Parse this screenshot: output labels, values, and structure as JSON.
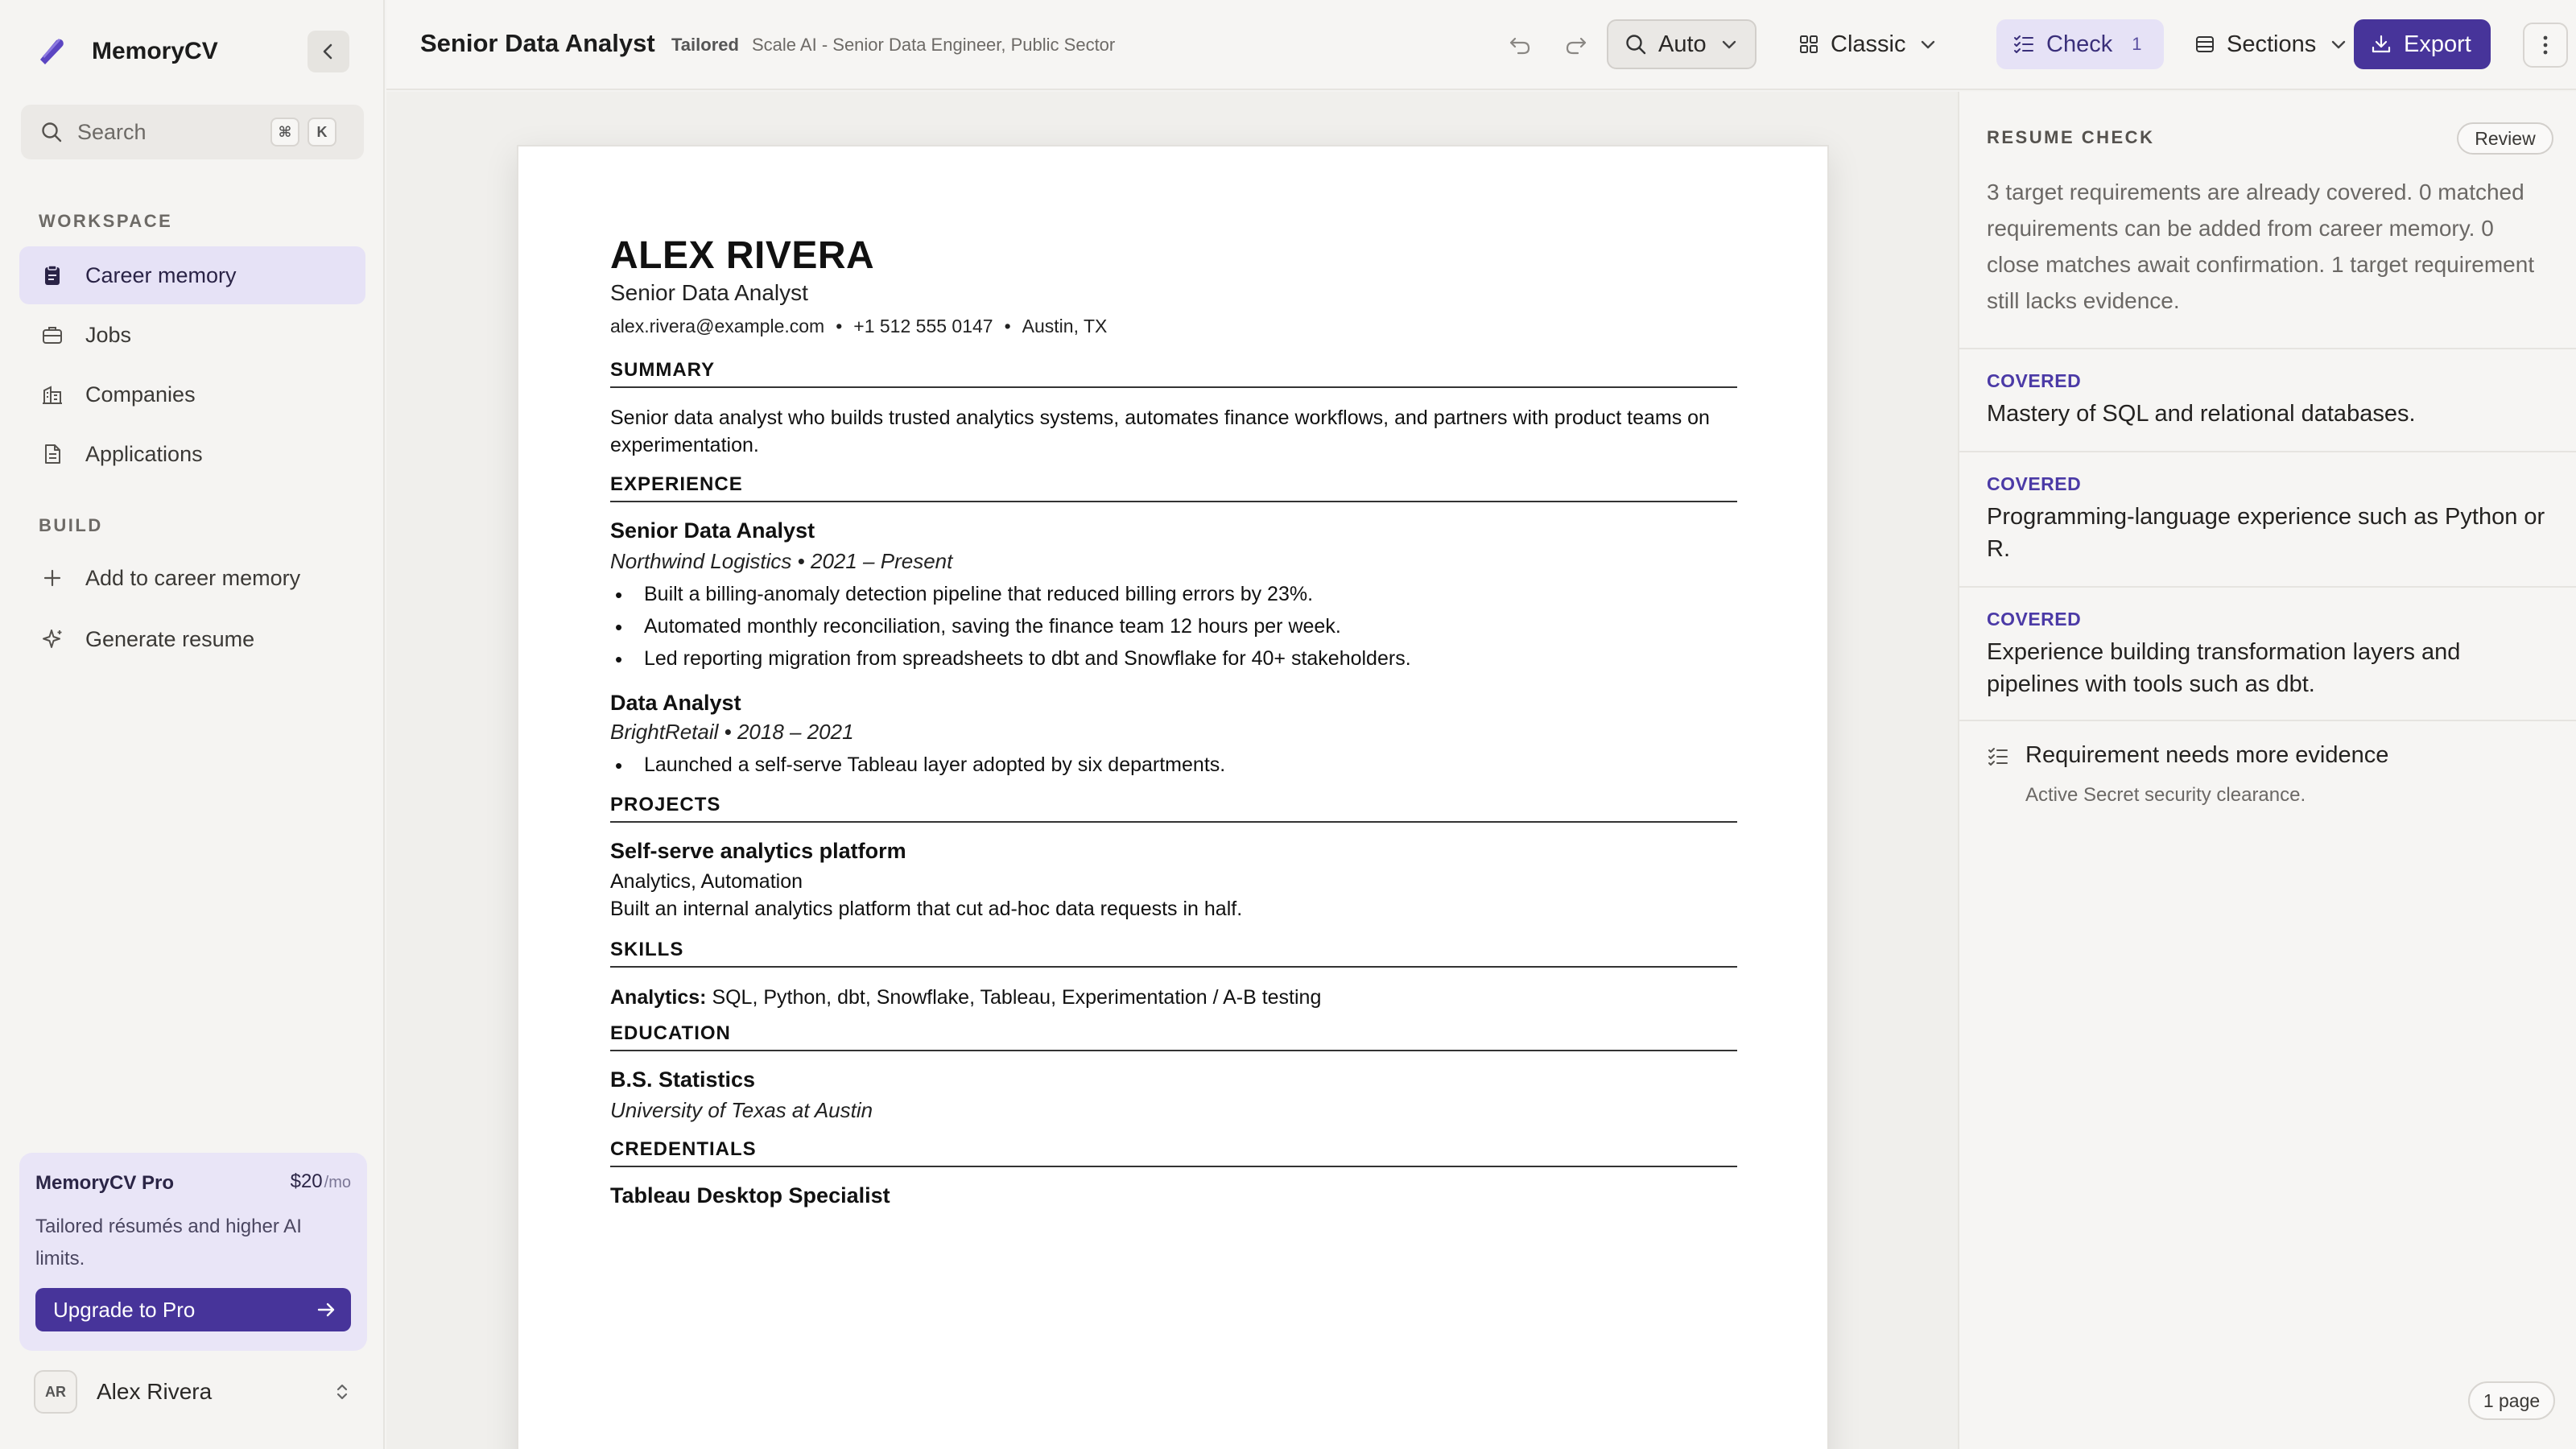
{
  "app": {
    "name": "MemoryCV"
  },
  "sidebar": {
    "search_label": "Search",
    "shortcut_keys": [
      "⌘",
      "K"
    ],
    "workspace_label": "WORKSPACE",
    "workspace_items": [
      {
        "label": "Career memory",
        "icon": "clipboard-icon",
        "active": true
      },
      {
        "label": "Jobs",
        "icon": "briefcase-icon"
      },
      {
        "label": "Companies",
        "icon": "building-icon"
      },
      {
        "label": "Applications",
        "icon": "document-icon"
      }
    ],
    "build_label": "BUILD",
    "build_items": [
      {
        "label": "Add to career memory",
        "icon": "plus-icon"
      },
      {
        "label": "Generate resume",
        "icon": "sparkle-icon"
      }
    ],
    "pro": {
      "title": "MemoryCV Pro",
      "price": "$20",
      "period": "/mo",
      "description": "Tailored résumés and higher AI limits.",
      "cta": "Upgrade to Pro"
    },
    "user": {
      "initials": "AR",
      "name": "Alex Rivera"
    }
  },
  "topbar": {
    "title": "Senior Data Analyst",
    "badge": "Tailored",
    "target": "Scale AI - Senior Data Engineer, Public Sector",
    "zoom_label": "Auto",
    "template_label": "Classic",
    "check_label": "Check",
    "check_count": "1",
    "sections_label": "Sections",
    "export_label": "Export"
  },
  "resume": {
    "name": "ALEX RIVERA",
    "role": "Senior Data Analyst",
    "email": "alex.rivera@example.com",
    "phone": "+1 512 555 0147",
    "location": "Austin, TX",
    "summary_heading": "SUMMARY",
    "summary": "Senior data analyst who builds trusted analytics systems, automates finance workflows, and partners with product teams on experimentation.",
    "experience_heading": "EXPERIENCE",
    "jobs": [
      {
        "title": "Senior Data Analyst",
        "meta": "Northwind Logistics • 2021 – Present",
        "bullets": [
          "Built a billing-anomaly detection pipeline that reduced billing errors by 23%.",
          "Automated monthly reconciliation, saving the finance team 12 hours per week.",
          "Led reporting migration from spreadsheets to dbt and Snowflake for 40+ stakeholders."
        ]
      },
      {
        "title": "Data Analyst",
        "meta": "BrightRetail • 2018 – 2021",
        "bullets": [
          "Launched a self-serve Tableau layer adopted by six departments."
        ]
      }
    ],
    "projects_heading": "PROJECTS",
    "project": {
      "title": "Self-serve analytics platform",
      "tags": "Analytics, Automation",
      "description": "Built an internal analytics platform that cut ad-hoc data requests in half."
    },
    "skills_heading": "SKILLS",
    "skills_label": "Analytics:",
    "skills": "SQL, Python, dbt, Snowflake, Tableau, Experimentation / A-B testing",
    "education_heading": "EDUCATION",
    "degree": "B.S. Statistics",
    "school": "University of Texas at Austin",
    "credentials_heading": "CREDENTIALS",
    "credential": "Tableau Desktop Specialist"
  },
  "check_panel": {
    "label": "RESUME CHECK",
    "review_label": "Review",
    "summary": "3 target requirements are already covered. 0 matched requirements can be added from career memory. 0 close matches await confirmation. 1 target requirement still lacks evidence.",
    "requirements": [
      {
        "status": "COVERED",
        "text": "Mastery of SQL and relational databases."
      },
      {
        "status": "COVERED",
        "text": "Programming-language experience such as Python or R."
      },
      {
        "status": "COVERED",
        "text": "Experience building transformation layers and pipelines with tools such as dbt."
      }
    ],
    "gap": {
      "title": "Requirement needs more evidence",
      "detail": "Active Secret security clearance."
    },
    "page_count": "1 page"
  },
  "colors": {
    "accent": "#47349a",
    "accent_soft": "#e6e2f6",
    "covered": "#4b3aa6"
  }
}
